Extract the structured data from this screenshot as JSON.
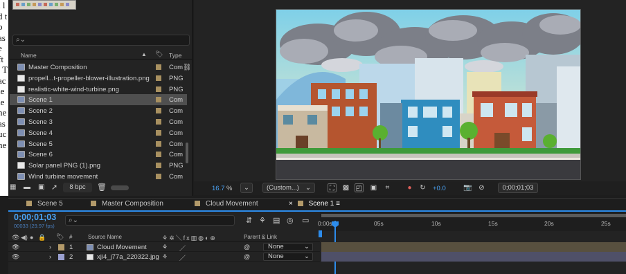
{
  "doc_strip": [
    "l l",
    "d t",
    "p",
    "as",
    "e",
    "ft",
    ". T",
    "",
    "ac",
    "le",
    "le",
    "ne",
    "as",
    "uc",
    "ne"
  ],
  "project": {
    "search_placeholder": "",
    "col_name": "Name",
    "col_type": "Type",
    "items": [
      {
        "name": "Master Composition",
        "type": "Com",
        "icon": "comp-icon",
        "label": "#a89060",
        "flow": true,
        "selected": false
      },
      {
        "name": "propell...t-propeller-blower-illustration.png",
        "type": "PNG",
        "icon": "file-icon",
        "label": "#a89060",
        "selected": false
      },
      {
        "name": "realistic-white-wind-turbine.png",
        "type": "PNG",
        "icon": "file-icon",
        "label": "#a89060",
        "selected": false
      },
      {
        "name": "Scene 1",
        "type": "Com",
        "icon": "comp-icon",
        "label": "#a89060",
        "selected": true
      },
      {
        "name": "Scene 2",
        "type": "Com",
        "icon": "comp-icon",
        "label": "#a89060",
        "selected": false
      },
      {
        "name": "Scene 3",
        "type": "Com",
        "icon": "comp-icon",
        "label": "#a89060",
        "selected": false
      },
      {
        "name": "Scene 4",
        "type": "Com",
        "icon": "comp-icon",
        "label": "#a89060",
        "selected": false
      },
      {
        "name": "Scene 5",
        "type": "Com",
        "icon": "comp-icon",
        "label": "#a89060",
        "selected": false
      },
      {
        "name": "Scene 6",
        "type": "Com",
        "icon": "comp-icon",
        "label": "#a89060",
        "selected": false
      },
      {
        "name": "Solar panel PNG (1).png",
        "type": "PNG",
        "icon": "file-icon",
        "label": "#a89060",
        "selected": false
      },
      {
        "name": "Wind turbine movement",
        "type": "Com",
        "icon": "comp-icon",
        "label": "#a89060",
        "selected": false
      }
    ],
    "bpc": "8 bpc"
  },
  "viewer": {
    "zoom": "16.7",
    "zoom_unit": "%",
    "resolution": "(Custom...)",
    "exposure": "+0.0",
    "timecode": "0;00;01;03"
  },
  "timeline": {
    "tabs": [
      {
        "label": "Scene 5",
        "active": false,
        "closable": false
      },
      {
        "label": "Master Composition",
        "active": false,
        "closable": false
      },
      {
        "label": "Cloud Movement",
        "active": false,
        "closable": false
      },
      {
        "label": "Scene 1",
        "active": true,
        "closable": true
      }
    ],
    "timecode": "0;00;01;03",
    "frame_info": "00033 (29.97 fps)",
    "header": {
      "hash": "#",
      "source_name": "Source Name",
      "parent": "Parent & Link"
    },
    "layers": [
      {
        "num": "1",
        "name": "Cloud Movement",
        "parent": "None",
        "label_color": "#b39a6a",
        "icon": "comp-icon"
      },
      {
        "num": "2",
        "name": "xji4_j77a_220322.jpg",
        "parent": "None",
        "label_color": "#9aa0d0",
        "icon": "file-icon"
      }
    ],
    "ruler_ticks": [
      "0:00s",
      "05s",
      "10s",
      "15s",
      "20s",
      "25s"
    ]
  },
  "colors": {
    "accent": "#2d8ceb",
    "selected_row": "#4f4f4f",
    "label_gold": "#a89060"
  }
}
